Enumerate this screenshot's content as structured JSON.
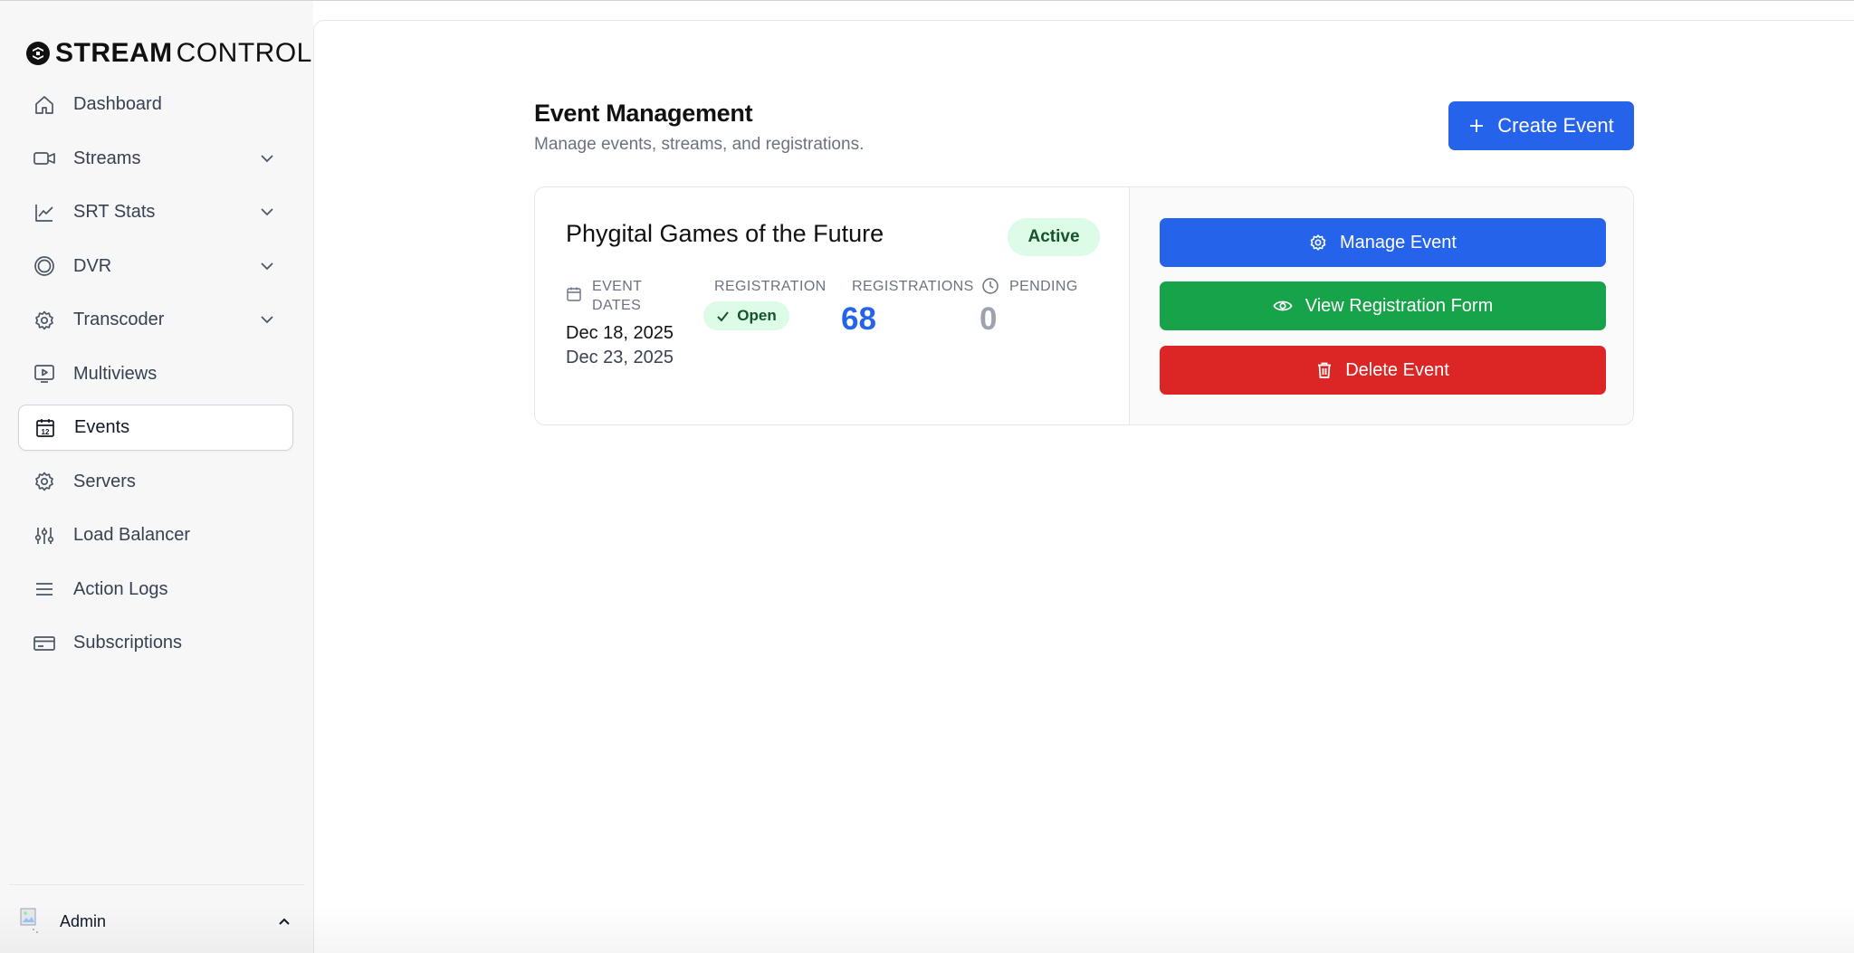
{
  "brand": {
    "bold": "STREAM",
    "light": "CONTROL"
  },
  "sidebar": {
    "items": [
      {
        "label": "Dashboard",
        "icon": "home-icon",
        "expandable": false
      },
      {
        "label": "Streams",
        "icon": "video-camera-icon",
        "expandable": true
      },
      {
        "label": "SRT Stats",
        "icon": "line-chart-icon",
        "expandable": true
      },
      {
        "label": "DVR",
        "icon": "record-circle-icon",
        "expandable": true
      },
      {
        "label": "Transcoder",
        "icon": "gear-icon",
        "expandable": true
      },
      {
        "label": "Multiviews",
        "icon": "monitor-play-icon",
        "expandable": false
      },
      {
        "label": "Events",
        "icon": "calendar-icon",
        "expandable": false,
        "active": true
      },
      {
        "label": "Servers",
        "icon": "gear-icon",
        "expandable": false
      },
      {
        "label": "Load Balancer",
        "icon": "sliders-icon",
        "expandable": false
      },
      {
        "label": "Action Logs",
        "icon": "list-icon",
        "expandable": false
      },
      {
        "label": "Subscriptions",
        "icon": "credit-card-icon",
        "expandable": false
      }
    ],
    "user": {
      "name": "Admin"
    }
  },
  "header": {
    "title": "Event Management",
    "subtitle": "Manage events, streams, and registrations.",
    "create_label": "Create Event"
  },
  "event": {
    "name": "Phygital Games of the Future",
    "status": "Active",
    "labels": {
      "dates": "EVENT DATES",
      "registration": "REGISTRATION",
      "registrations": "REGISTRATIONS",
      "pending": "PENDING"
    },
    "start_date": "Dec 18, 2025",
    "end_date": "Dec 23, 2025",
    "registration_status": "Open",
    "registrations_count": "68",
    "pending_count": "0",
    "actions": {
      "manage": "Manage Event",
      "view_form": "View Registration Form",
      "delete": "Delete Event"
    }
  },
  "colors": {
    "primary": "#2563eb",
    "success": "#16a34a",
    "danger": "#dc2626",
    "pill_bg": "#dcfce7"
  }
}
